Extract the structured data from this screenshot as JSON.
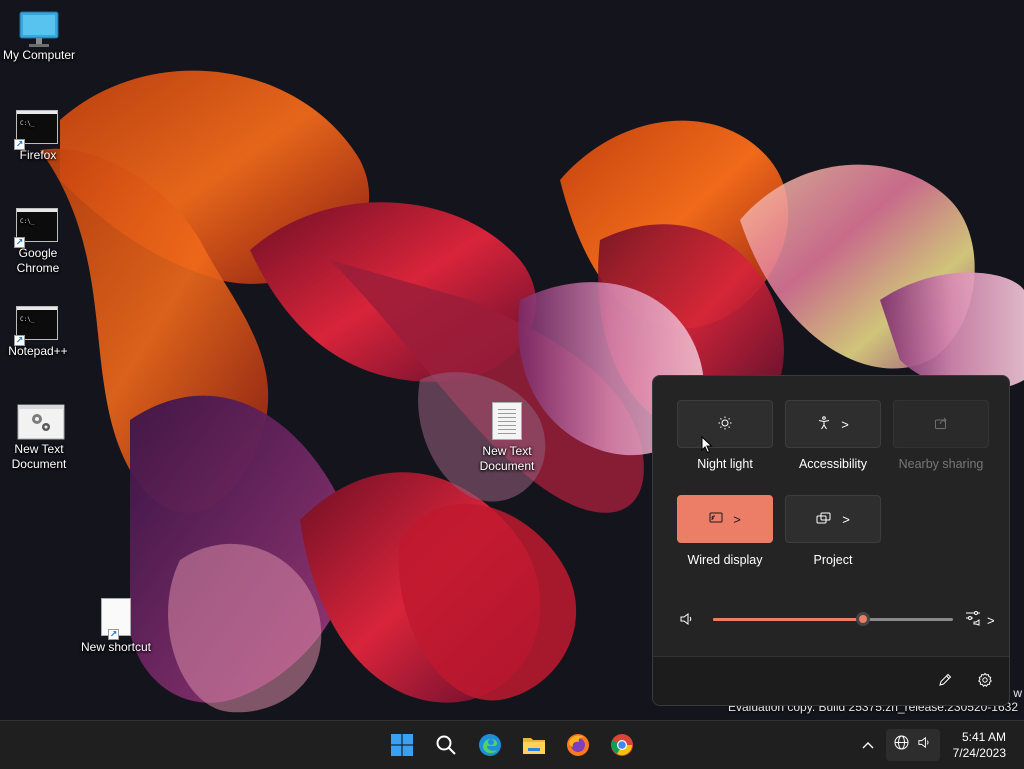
{
  "desktop": {
    "icons": [
      {
        "label": "My Computer"
      },
      {
        "label": "Firefox"
      },
      {
        "label": "Google Chrome"
      },
      {
        "label": "Notepad++"
      },
      {
        "label": "New Text Document"
      },
      {
        "label": "New Text Document"
      },
      {
        "label": "New shortcut"
      }
    ],
    "watermark": "Evaluation copy. Build 25375.zn_release.230520-1632",
    "watermark_fragment": "w"
  },
  "quick_settings": {
    "tiles": [
      {
        "label": "Night light",
        "icon": "brightness-icon",
        "state": "off"
      },
      {
        "label": "Accessibility",
        "icon": "accessibility-icon",
        "chevron": ">",
        "state": "off"
      },
      {
        "label": "Nearby sharing",
        "icon": "share-icon",
        "state": "disabled"
      },
      {
        "label": "Wired display",
        "icon": "cast-icon",
        "chevron": ">",
        "state": "on"
      },
      {
        "label": "Project",
        "icon": "project-icon",
        "chevron": ">",
        "state": "off"
      }
    ],
    "volume": {
      "level": 0.625,
      "icon": "speaker-icon",
      "mixer_chevron": ">"
    },
    "footer": {
      "edit_icon": "pencil-icon",
      "settings_icon": "gear-icon"
    }
  },
  "taskbar": {
    "apps": [
      "windows-start-icon",
      "search-icon",
      "edge-icon",
      "file-explorer-icon",
      "firefox-icon",
      "chrome-icon"
    ],
    "tray": {
      "overflow_chevron": "^",
      "network_icon": "globe-icon",
      "volume_icon": "speaker-icon"
    },
    "clock": {
      "time": "5:41 AM",
      "date": "7/24/2023"
    }
  },
  "colors": {
    "accent": "#ec7e67",
    "panel": "#242424",
    "taskbar": "#1f1f1f"
  }
}
